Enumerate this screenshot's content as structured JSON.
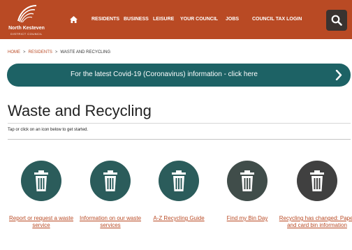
{
  "header": {
    "logo_name": "North Kesteven",
    "logo_sub": "DISTRICT COUNCIL",
    "nav": [
      "RESIDENTS",
      "BUSINESS",
      "LEISURE",
      "YOUR COUNCIL",
      "JOBS",
      "COUNCIL TAX LOGIN"
    ],
    "colors": {
      "header_bg": "#b94a24",
      "search_bg": "#3a3330"
    }
  },
  "breadcrumb": {
    "home": "HOME",
    "residents": "RESIDENTS",
    "current": "WASTE AND RECYCLING",
    "separator": ">"
  },
  "banner": {
    "text": "For the latest Covid-19 (Coronavirus) information - click here",
    "color": "#1d6265"
  },
  "page": {
    "title": "Waste and Recycling",
    "instructions": "Tap or click on an icon below to get started."
  },
  "tiles": [
    {
      "label": "Report or request a waste service",
      "icon": "bin-icon",
      "color": "#2b5c5b"
    },
    {
      "label": "Information on our waste services",
      "icon": "bin-icon",
      "color": "#2b5c5b"
    },
    {
      "label": "A-Z Recycling Guide",
      "icon": "bin-icon",
      "color": "#2b5c5b"
    },
    {
      "label": "Find my Bin Day",
      "icon": "bin-icon",
      "color": "#404d4a"
    },
    {
      "label": "Recycling has changed: Paper and card bin information",
      "icon": "bin-icon",
      "color": "#404040"
    }
  ]
}
